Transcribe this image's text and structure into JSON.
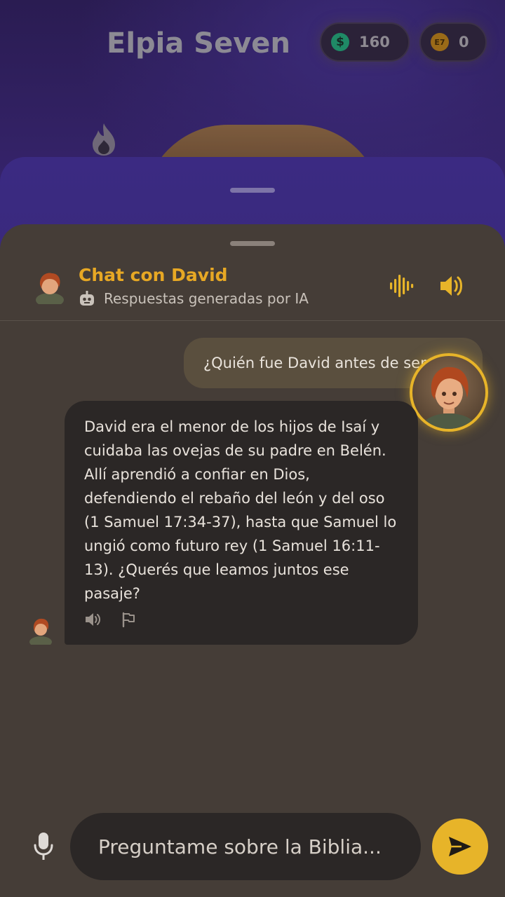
{
  "game": {
    "title": "Elpia Seven",
    "money_symbol": "$",
    "money_value": "160",
    "coin_symbol": "E7",
    "coin_value": "0"
  },
  "chat": {
    "title": "Chat con David",
    "subtitle": "Respuestas generadas por IA",
    "messages": [
      {
        "role": "user",
        "text": "¿Quién fue David antes de ser rey?"
      },
      {
        "role": "bot",
        "text": "David era el menor de los hijos de Isaí y cuidaba las ovejas de su padre en Belén. Allí aprendió a confiar en Dios, defendiendo el rebaño del león y del oso (1 Samuel 17:34-37), hasta que Samuel lo ungió como futuro rey (1 Samuel 16:11-13). ¿Querés que leamos juntos ese pasaje?"
      }
    ],
    "input_placeholder": "Preguntame sobre la Biblia..."
  },
  "colors": {
    "accent": "#e7b429",
    "title_gold": "#e7a824",
    "sheet_bg": "#453d37",
    "bubble_bot": "#2b2726",
    "bubble_user": "#5a4f3e"
  },
  "icons": [
    "flame-icon",
    "robot-icon",
    "voice-wave-icon",
    "speaker-icon",
    "flag-icon",
    "mic-icon",
    "send-icon"
  ]
}
